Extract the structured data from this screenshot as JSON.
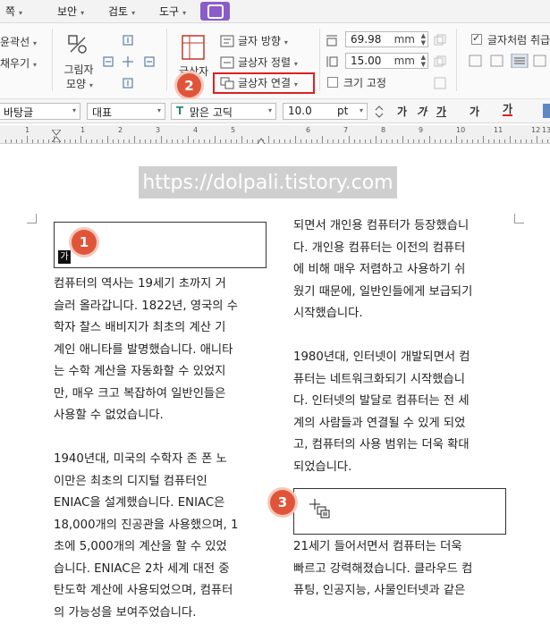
{
  "menu": {
    "items": [
      {
        "label": "쪽"
      },
      {
        "label": "보안"
      },
      {
        "label": "검토"
      },
      {
        "label": "도구"
      }
    ]
  },
  "ribbon": {
    "left_partial": {
      "line1": "윤곽선",
      "line2": "채우기"
    },
    "shape_btn": {
      "line1": "그림자",
      "line2": "모양"
    },
    "textbox_btn": "글상자",
    "text_direction": "글자 방향",
    "textbox_align": "글상자 정렬",
    "textbox_link": "글상자 연결",
    "width_value": "69.98",
    "height_value": "15.00",
    "unit": "mm",
    "size_fix": "크기 고정",
    "treat_as_char": "글자처럼 취급"
  },
  "format": {
    "style": "바탕글",
    "lang": "대표",
    "font": "맑은 고딕",
    "size": "10.0",
    "size_unit": "pt",
    "btn_bold": "가",
    "btn_italic": "가",
    "btn_under": "가",
    "btn_strike": "가",
    "btn_color": "가"
  },
  "ruler": {
    "n1": "1",
    "n2": "1",
    "n3": "2",
    "n4": "3",
    "n5": "4",
    "n6": "5",
    "n7": "6",
    "n8": "7",
    "n9": "8",
    "n10": "9",
    "n11": "10",
    "n12": "11",
    "n13": "12",
    "n14": "13"
  },
  "watermark": "https://dolpali.tistory.com",
  "markers": {
    "m1": "1",
    "m2": "2",
    "m3": "3"
  },
  "textbox1_char": "가",
  "left_column": [
    " 컴퓨터의 역사는 19세기 초까지 거",
    "슬러 올라갑니다. 1822년, 영국의 수",
    "학자 찰스 배비지가 최초의 계산 기",
    "계인 애니타를 발명했습니다. 애니타",
    "는 수학 계산을 자동화할 수 있었지",
    "만, 매우 크고 복잡하여 일반인들은",
    "사용할 수 없었습니다.",
    "",
    "1940년대, 미국의 수학자 존 폰 노",
    "이만은  최초의  디지털  컴퓨터인",
    "ENIAC을  설계했습니다.  ENIAC은",
    "18,000개의 진공관을 사용했으며, 1",
    "초에 5,000개의 계산을 할 수 있었",
    "습니다. ENIAC은 2차 세계 대전 중",
    "탄도학 계산에 사용되었으며, 컴퓨터",
    "의 가능성을 보여주었습니다."
  ],
  "right_column_top": [
    "되면서 개인용 컴퓨터가 등장했습니",
    "다. 개인용 컴퓨터는 이전의 컴퓨터",
    "에 비해 매우 저렴하고 사용하기 쉬",
    "웠기 때문에, 일반인들에게 보급되기",
    "시작했습니다.",
    "",
    "1980년대, 인터넷이 개발되면서 컴",
    "퓨터는  네트워크화되기  시작했습니",
    "다. 인터넷의 발달로 컴퓨터는 전 세",
    "계의 사람들과 연결될 수 있게 되었",
    "고, 컴퓨터의 사용 범위는 더욱 확대",
    "되었습니다."
  ],
  "right_column_bottom": [
    "21세기  들어서면서  컴퓨터는  더욱",
    "빠르고 강력해졌습니다. 클라우드 컴",
    "퓨팅, 인공지능, 사물인터넷과 같은"
  ]
}
